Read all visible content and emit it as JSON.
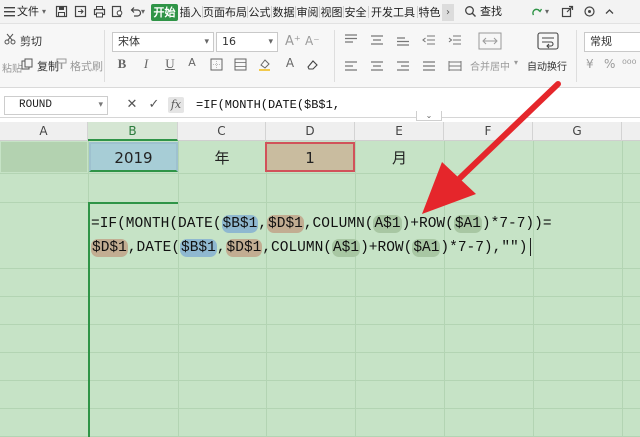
{
  "menubar": {
    "file_label": "文件",
    "tabs": [
      "开始",
      "插入",
      "页面布局",
      "公式",
      "数据",
      "审阅",
      "视图",
      "安全",
      "开发工具",
      "特色"
    ],
    "search_label": "查找"
  },
  "ribbon": {
    "cut_label": "剪切",
    "paste_label": "粘贴",
    "copy_label": "复制",
    "format_painter_label": "格式刷",
    "font_name": "宋体",
    "font_size": "16",
    "merge_label": "合并居中",
    "wrap_label": "自动换行",
    "number_format": "常规"
  },
  "formula_bar": {
    "name_box": "ROUND",
    "fx_label": "fx",
    "input_text": "=IF(MONTH(DATE($B$1,"
  },
  "columns": [
    "A",
    "B",
    "C",
    "D",
    "E",
    "F",
    "G"
  ],
  "selected_column": "B",
  "row1": {
    "b1": "2019",
    "c1": "年",
    "d1": "1",
    "e1": "月"
  },
  "formula_lines": {
    "line1": [
      {
        "t": "=IF(MONTH(DATE(",
        "c": ""
      },
      {
        "t": "$B$1",
        "c": "blue"
      },
      {
        "t": ",",
        "c": ""
      },
      {
        "t": "$D$1",
        "c": "brown"
      },
      {
        "t": ",COLUMN(",
        "c": ""
      },
      {
        "t": "A$1",
        "c": "green"
      },
      {
        "t": ")+ROW(",
        "c": ""
      },
      {
        "t": "$A1",
        "c": "green"
      },
      {
        "t": ")*7-7))=",
        "c": ""
      }
    ],
    "line2": [
      {
        "t": "$D$1",
        "c": "brown"
      },
      {
        "t": ",DATE(",
        "c": ""
      },
      {
        "t": "$B$1",
        "c": "blue"
      },
      {
        "t": ",",
        "c": ""
      },
      {
        "t": "$D$1",
        "c": "brown"
      },
      {
        "t": ",COLUMN(",
        "c": ""
      },
      {
        "t": "A$1",
        "c": "green"
      },
      {
        "t": ")+ROW(",
        "c": ""
      },
      {
        "t": "$A1",
        "c": "green"
      },
      {
        "t": ")*7-7),\"\")",
        "c": ""
      }
    ]
  },
  "colors": {
    "accent": "#2f9447",
    "sheet_bg": "#c6e3c6",
    "arrow": "#e5262b"
  }
}
